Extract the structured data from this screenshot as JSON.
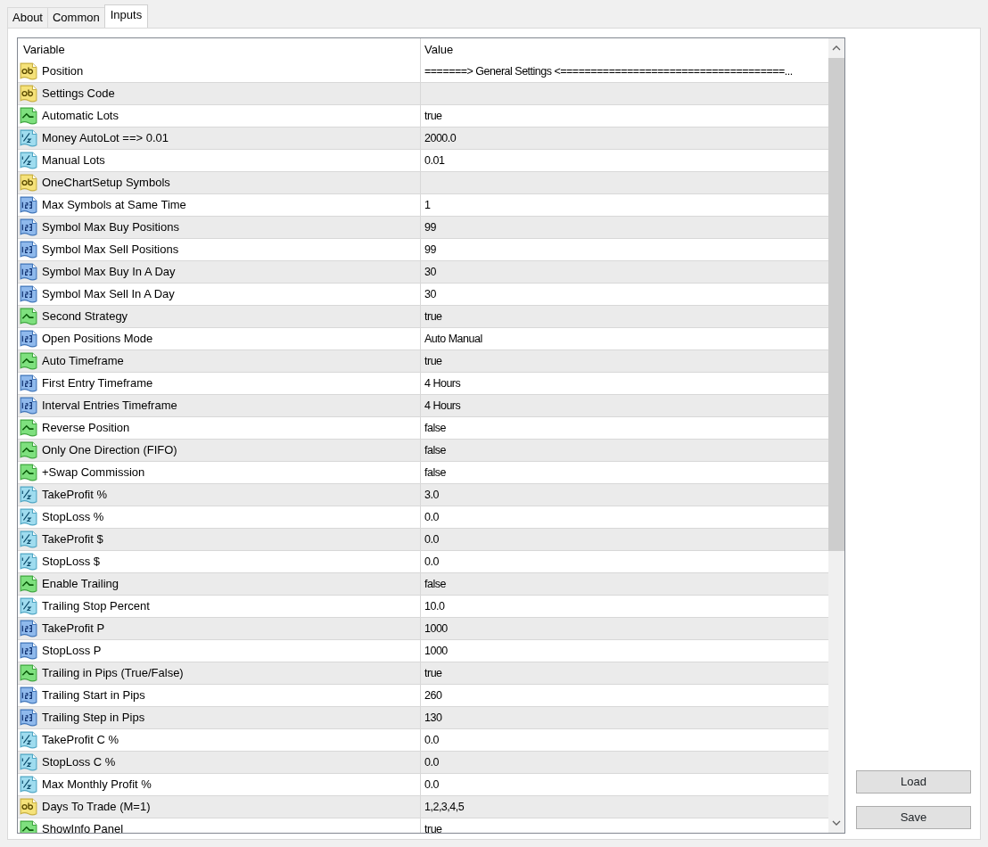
{
  "tabs": [
    {
      "label": "About",
      "selected": false
    },
    {
      "label": "Common",
      "selected": false
    },
    {
      "label": "Inputs",
      "selected": true
    }
  ],
  "table": {
    "columns": [
      "Variable",
      "Value"
    ],
    "rows": [
      {
        "kind": "string",
        "variable": "Position",
        "value": "=======>  General Settings <=====================================..."
      },
      {
        "kind": "string",
        "variable": "Settings Code",
        "value": ""
      },
      {
        "kind": "bool",
        "variable": "Automatic Lots",
        "value": "true"
      },
      {
        "kind": "double",
        "variable": "Money AutoLot ==> 0.01",
        "value": "2000.0"
      },
      {
        "kind": "double",
        "variable": "Manual Lots",
        "value": "0.01"
      },
      {
        "kind": "string",
        "variable": "OneChartSetup Symbols",
        "value": ""
      },
      {
        "kind": "int",
        "variable": "Max Symbols at Same Time",
        "value": "1"
      },
      {
        "kind": "int",
        "variable": "Symbol Max Buy Positions",
        "value": "99"
      },
      {
        "kind": "int",
        "variable": "Symbol Max Sell Positions",
        "value": "99"
      },
      {
        "kind": "int",
        "variable": "Symbol Max Buy In A Day",
        "value": "30"
      },
      {
        "kind": "int",
        "variable": "Symbol Max Sell In A Day",
        "value": "30"
      },
      {
        "kind": "bool",
        "variable": "Second Strategy",
        "value": "true"
      },
      {
        "kind": "int",
        "variable": "Open Positions Mode",
        "value": "Auto Manual"
      },
      {
        "kind": "bool",
        "variable": "Auto Timeframe",
        "value": "true"
      },
      {
        "kind": "int",
        "variable": "First Entry Timeframe",
        "value": "4 Hours"
      },
      {
        "kind": "int",
        "variable": "Interval Entries Timeframe",
        "value": "4 Hours"
      },
      {
        "kind": "bool",
        "variable": "Reverse Position",
        "value": "false"
      },
      {
        "kind": "bool",
        "variable": "Only One Direction (FIFO)",
        "value": "false"
      },
      {
        "kind": "bool",
        "variable": "+Swap Commission",
        "value": "false"
      },
      {
        "kind": "double",
        "variable": "TakeProfit %",
        "value": "3.0"
      },
      {
        "kind": "double",
        "variable": "StopLoss %",
        "value": "0.0"
      },
      {
        "kind": "double",
        "variable": "TakeProfit $",
        "value": "0.0"
      },
      {
        "kind": "double",
        "variable": "StopLoss $",
        "value": "0.0"
      },
      {
        "kind": "bool",
        "variable": "Enable Trailing",
        "value": "false"
      },
      {
        "kind": "double",
        "variable": "Trailing Stop Percent",
        "value": "10.0"
      },
      {
        "kind": "int",
        "variable": "TakeProfit P",
        "value": "1000"
      },
      {
        "kind": "int",
        "variable": "StopLoss P",
        "value": "1000"
      },
      {
        "kind": "bool",
        "variable": "Trailing in Pips (True/False)",
        "value": "true"
      },
      {
        "kind": "int",
        "variable": "Trailing Start in Pips",
        "value": "260"
      },
      {
        "kind": "int",
        "variable": "Trailing Step in Pips",
        "value": "130"
      },
      {
        "kind": "double",
        "variable": "TakeProfit C %",
        "value": "0.0"
      },
      {
        "kind": "double",
        "variable": "StopLoss C %",
        "value": "0.0"
      },
      {
        "kind": "double",
        "variable": "Max Monthly Profit %",
        "value": "0.0"
      },
      {
        "kind": "string",
        "variable": "Days To Trade (M=1)",
        "value": "1,2,3,4,5"
      },
      {
        "kind": "bool",
        "variable": "ShowInfo Panel",
        "value": "true"
      }
    ]
  },
  "buttons": [
    "Load",
    "Save"
  ]
}
